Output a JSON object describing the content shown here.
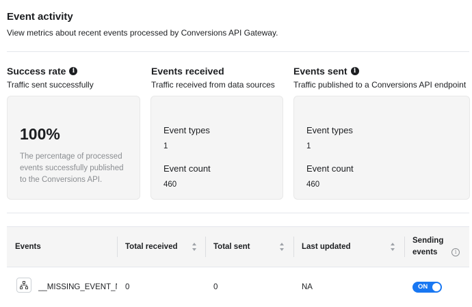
{
  "header": {
    "title": "Event activity",
    "description": "View metrics about recent events processed by Conversions API Gateway."
  },
  "cards": {
    "success": {
      "title": "Success rate",
      "subtitle": "Traffic sent successfully",
      "value": "100%",
      "note": "The percentage of processed events successfully published to the Conversions API."
    },
    "received": {
      "title": "Events received",
      "subtitle": "Traffic received from data sources",
      "types_label": "Event types",
      "types_value": "1",
      "count_label": "Event count",
      "count_value": "460"
    },
    "sent": {
      "title": "Events sent",
      "subtitle": "Traffic published to a Conversions API endpoint",
      "types_label": "Event types",
      "types_value": "1",
      "count_label": "Event count",
      "count_value": "460"
    }
  },
  "table": {
    "columns": [
      "Events",
      "Total received",
      "Total sent",
      "Last updated",
      "Sending events"
    ],
    "rows": [
      {
        "event": "__MISSING_EVENT_NA",
        "total_received": "0",
        "total_sent": "0",
        "last_updated": "NA",
        "sending": "ON"
      }
    ]
  },
  "colors": {
    "accent": "#1877f2",
    "card_bg": "#f5f5f5",
    "muted_text": "#8a8d91"
  },
  "icons": {
    "info": "info-icon",
    "sort": "sort-icon",
    "event_row": "hierarchy-icon"
  }
}
